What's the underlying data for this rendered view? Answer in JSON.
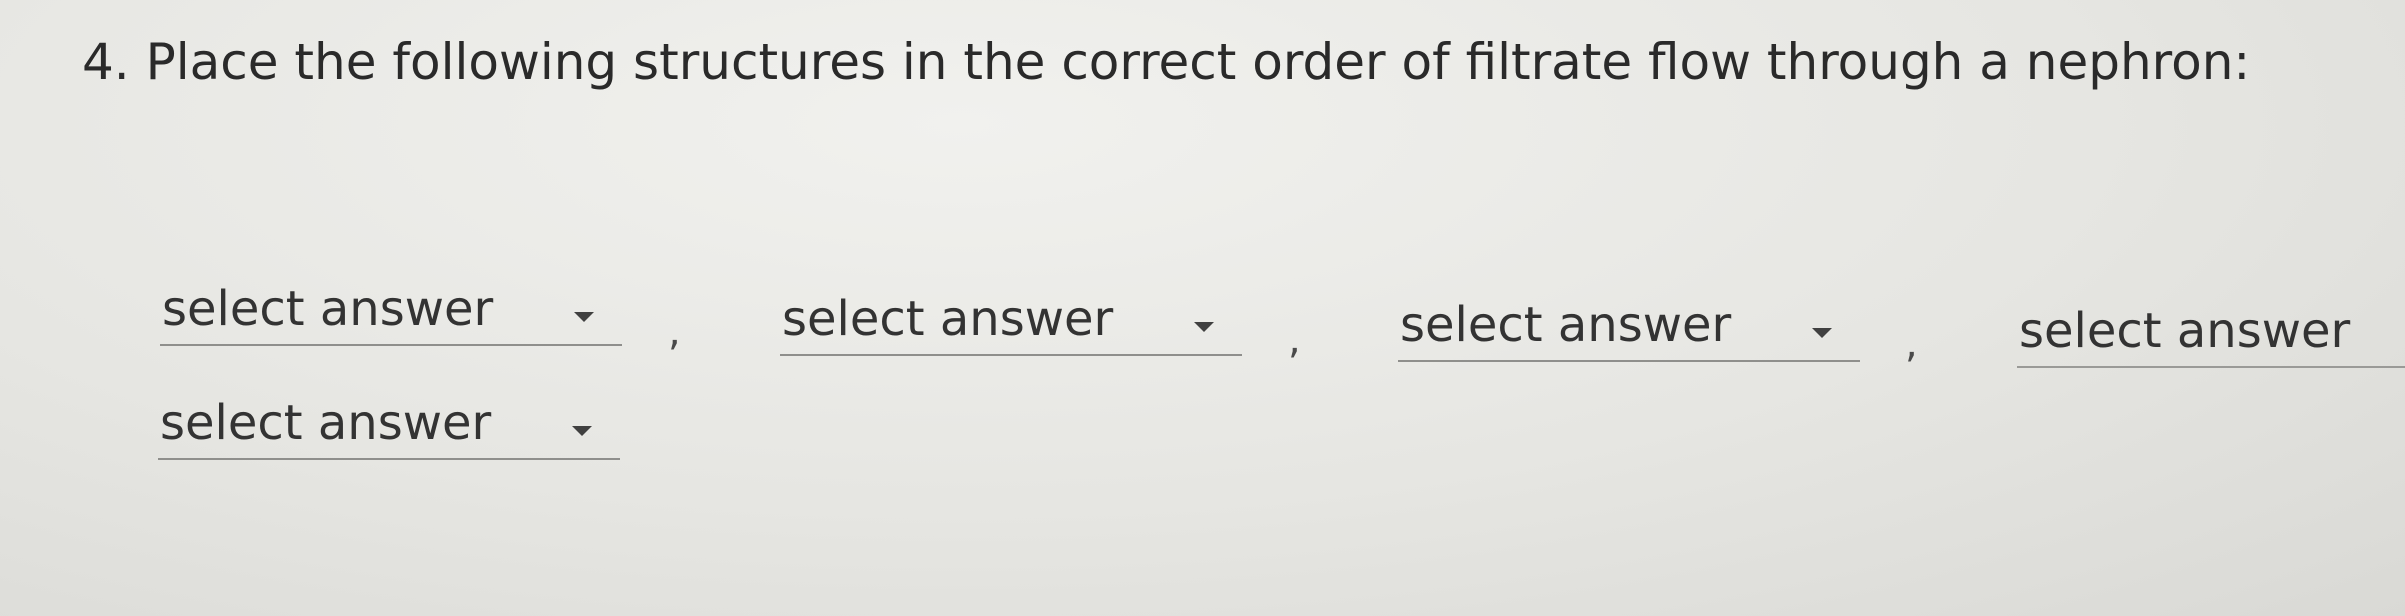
{
  "question": {
    "text": "4. Place the following structures in the correct order of filtrate flow through a nephron:"
  },
  "dropdowns": [
    {
      "value": "select answer",
      "icon": "chevron-down-icon"
    },
    {
      "value": "select answer",
      "icon": "chevron-down-icon"
    },
    {
      "value": "select answer",
      "icon": "chevron-down-icon"
    },
    {
      "value": "select answer",
      "icon": "chevron-down-icon"
    },
    {
      "value": "select answer",
      "icon": "chevron-down-icon"
    }
  ],
  "separator": ","
}
